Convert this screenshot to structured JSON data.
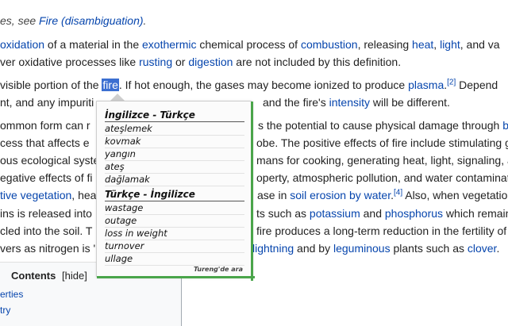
{
  "hatnote": {
    "prefix": "es, see ",
    "link": "Fire (disambiguation)",
    "suffix": "."
  },
  "para1": {
    "line1": [
      "oxidation",
      " of a material in the ",
      "exothermic",
      " chemical process of ",
      "combustion",
      ", releasing ",
      "heat",
      ", ",
      "light",
      ", and va"
    ],
    "line2": [
      "ver oxidative processes like ",
      "rusting",
      " or ",
      "digestion",
      " are not included by this definition."
    ]
  },
  "para2": {
    "line1_pre": " visible portion of the ",
    "highlight": "fire",
    "line1_mid": ". If hot enough, the gases may become ionized to produce ",
    "line1_link": "plasma",
    "line1_ref": "[2]",
    "line1_post": " Depend",
    "line2_pre": "nt, and any impuriti",
    "line2_mid": "and the fire's ",
    "line2_link": "intensity",
    "line2_post": " will be different."
  },
  "para3": {
    "l1_left": "ommon form can r",
    "l1_right_a": "s the potential to cause physical damage through ",
    "l1_right_link": "bu",
    "l2_left": "cess that affects e",
    "l2_right": "obe. The positive effects of fire include stimulating g",
    "l3_left": "ous ecological syste",
    "l3_right": "mans for cooking, generating heat, light, signaling, a",
    "l4_left": "egative effects of fi",
    "l4_right": "operty, atmospheric pollution, and water contaminat",
    "l5_left_link": "tive vegetation",
    "l5_left": ", hea",
    "l5_right_a": "ase in ",
    "l5_right_link": "soil erosion by water",
    "l5_right_ref": "[4]",
    "l5_right_b": " Also, when vegetation",
    "l6_left": "ins is released into",
    "l6_right_a": "ts such as ",
    "l6_right_link1": "potassium",
    "l6_right_b": " and ",
    "l6_right_link2": "phosphorus",
    "l6_right_c": " which remain",
    "l7_left": "cled into the soil. T",
    "l7_right": "fire produces a long-term reduction in the fertility of",
    "l8_left": "vers as nitrogen is '",
    "l8_right_link1": "lightning",
    "l8_right_a": " and by ",
    "l8_right_link2": "leguminous",
    "l8_right_b": " plants such as ",
    "l8_right_link3": "clover",
    "l8_right_c": "."
  },
  "toc": {
    "title": "Contents",
    "hide": "[hide]",
    "items": [
      "erties",
      "try"
    ]
  },
  "popup": {
    "section1_title": "İngilizce - Türkçe",
    "section1_words": [
      "ateşlemek",
      "kovmak",
      "yangın",
      "ateş",
      "dağlamak"
    ],
    "section2_title": "Türkçe - İngilizce",
    "section2_words": [
      "wastage",
      "outage",
      "loss in weight",
      "turnover",
      "ullage"
    ],
    "footer": "Tureng'de ara"
  },
  "colors": {
    "link": "#0645ad",
    "highlight": "#3b6fd1",
    "popup_accent": "#4aa54a"
  }
}
